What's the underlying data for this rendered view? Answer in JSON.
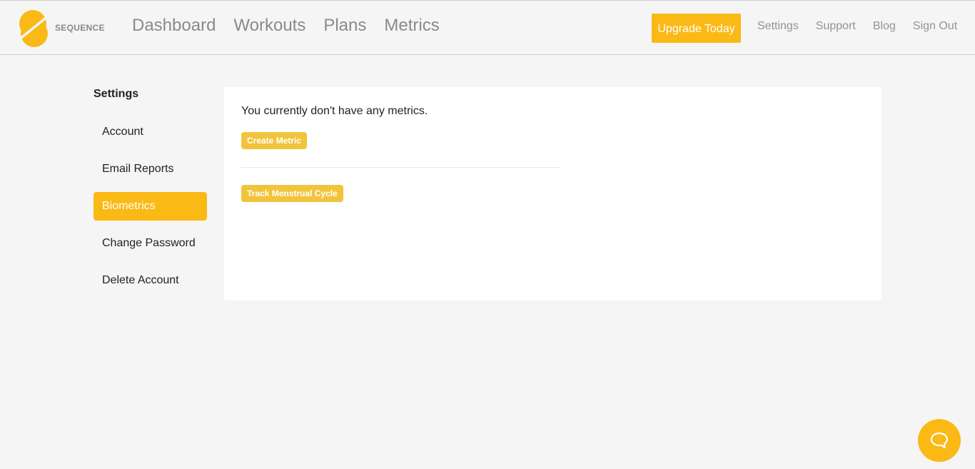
{
  "header": {
    "brand": "SEQUENCE",
    "nav": [
      "Dashboard",
      "Workouts",
      "Plans",
      "Metrics"
    ],
    "upgrade_label": "Upgrade Today",
    "right_nav": [
      "Settings",
      "Support",
      "Blog",
      "Sign Out"
    ]
  },
  "sidebar": {
    "title": "Settings",
    "items": [
      {
        "label": "Account"
      },
      {
        "label": "Email Reports"
      },
      {
        "label": "Biometrics"
      },
      {
        "label": "Change Password"
      },
      {
        "label": "Delete Account"
      }
    ],
    "active": "Biometrics"
  },
  "panel": {
    "empty_message": "You currently don't have any metrics.",
    "create_label": "Create Metric",
    "track_label": "Track Menstrual Cycle"
  },
  "colors": {
    "accent": "#fbb916",
    "button": "#f1c43c",
    "background": "#f5f5f5"
  },
  "icons": {
    "logo": "sequence-logo-icon",
    "chat": "chat-icon"
  }
}
